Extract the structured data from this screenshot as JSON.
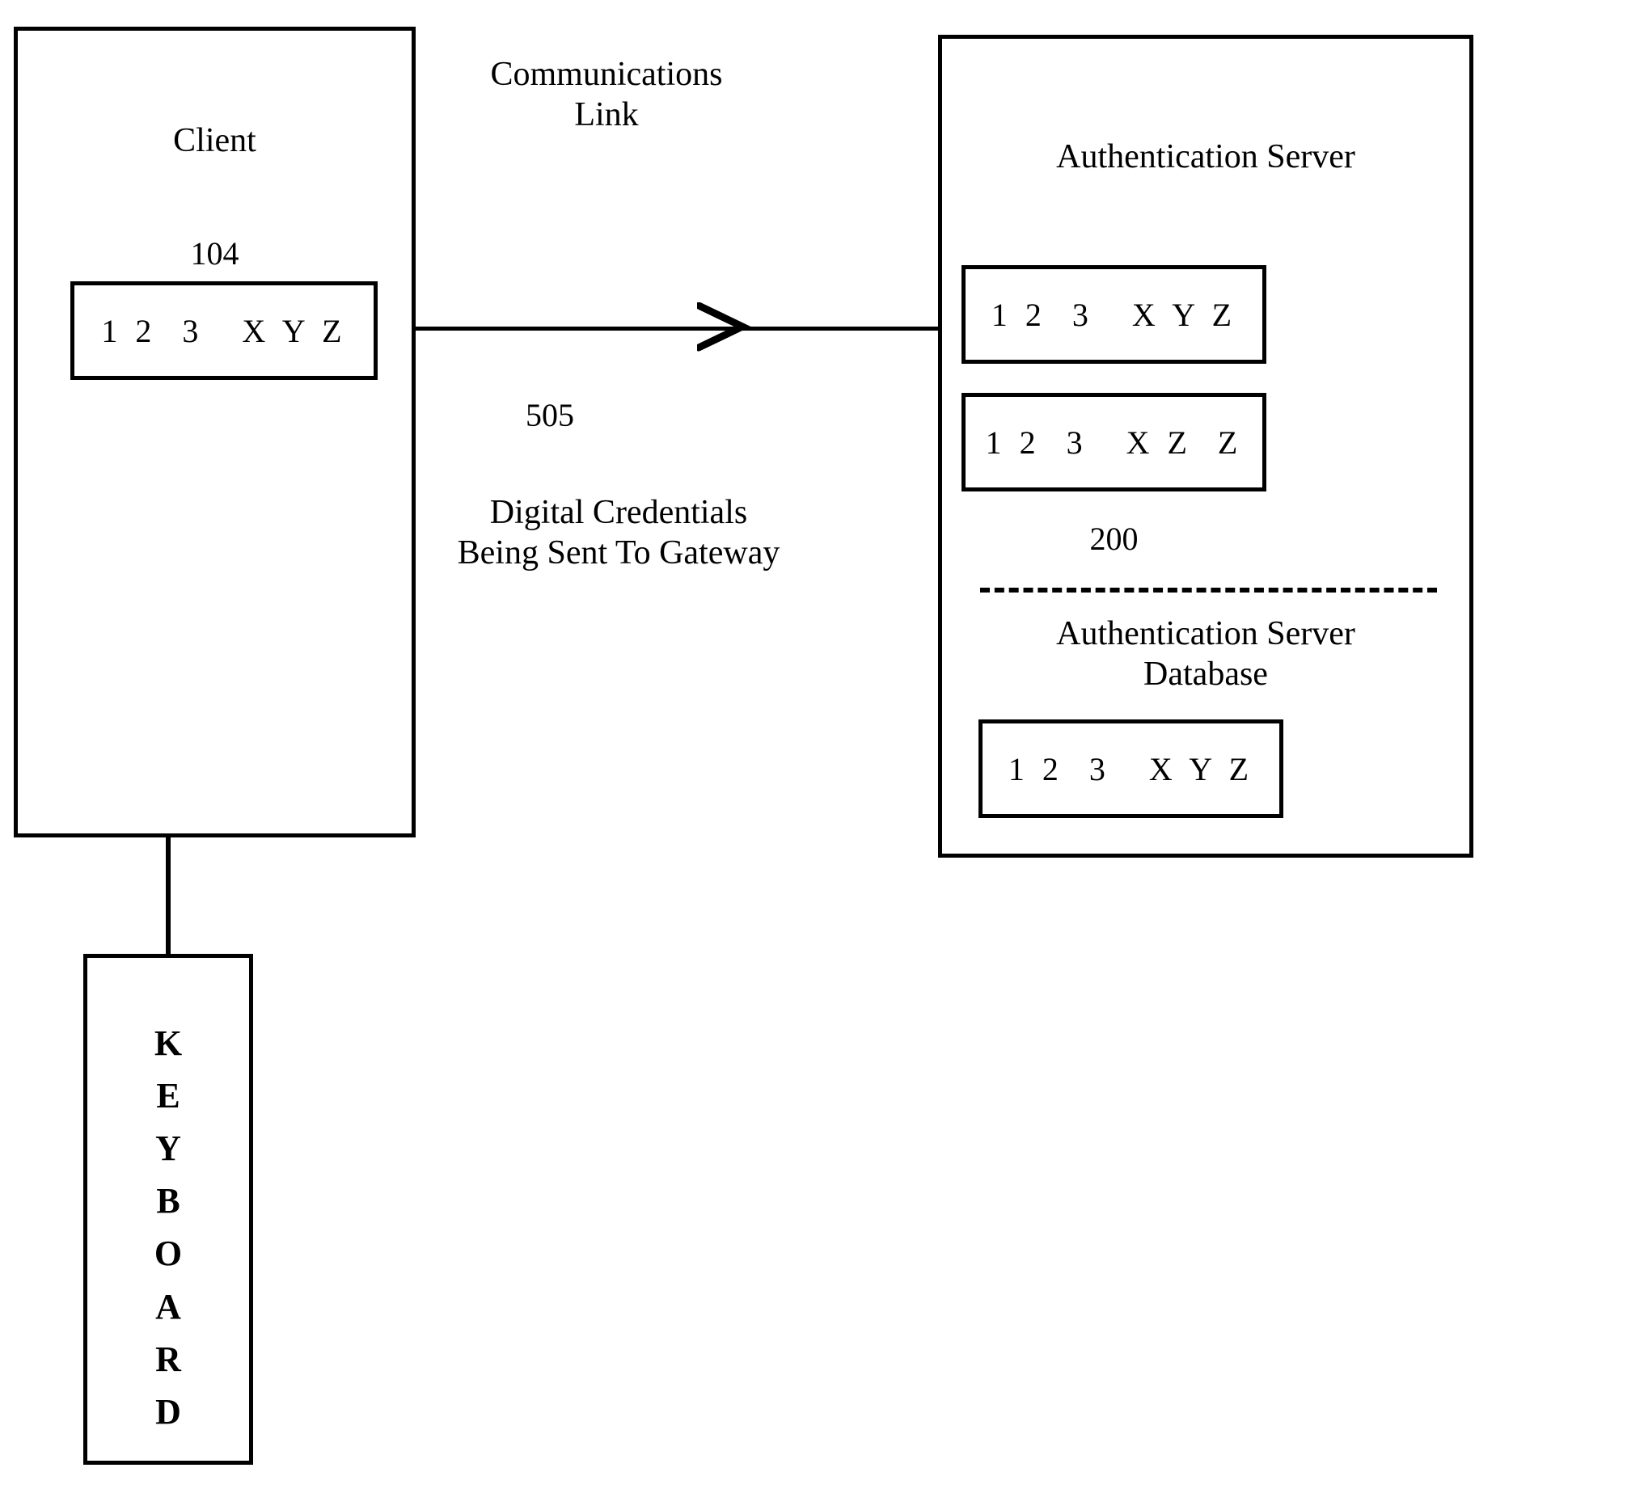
{
  "diagram": {
    "client": {
      "title": "Client",
      "reference_number": "104",
      "credential": "1 2  3   X Y Z"
    },
    "keyboard": {
      "letters": [
        "K",
        "E",
        "Y",
        "B",
        "O",
        "A",
        "R",
        "D"
      ],
      "label": "KEYBOARD"
    },
    "communications_link": {
      "label": "Communications\nLink",
      "reference_number": "505",
      "caption": "Digital Credentials\nBeing Sent To Gateway"
    },
    "server": {
      "title": "Authentication Server",
      "reference_number": "200",
      "credentials": [
        "1 2  3   X Y Z",
        "1 2  3   X Z  Z"
      ],
      "database": {
        "title": "Authentication Server\nDatabase",
        "credential": "1 2  3   X Y Z"
      }
    }
  },
  "colors": {
    "stroke": "#000000",
    "background": "#ffffff"
  }
}
